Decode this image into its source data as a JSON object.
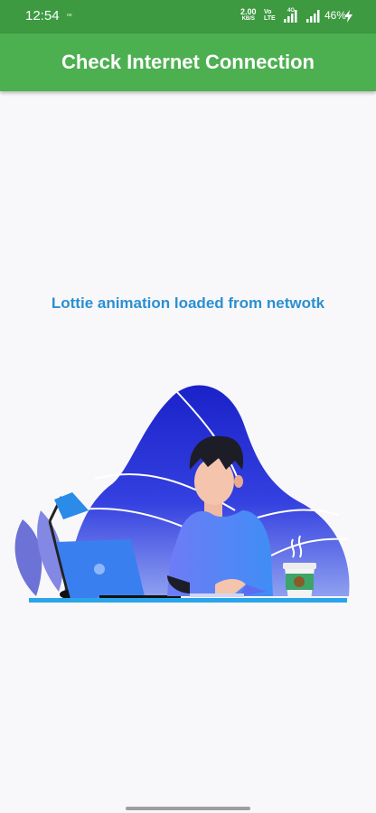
{
  "status_bar": {
    "time": "12:54",
    "app_icon": "oo",
    "net_speed": "2.00",
    "net_speed_unit": "KB/S",
    "volte_line1": "Vo",
    "volte_line2": "LTE",
    "network": "4G",
    "battery": "46%",
    "icons": [
      "signal-icon",
      "signal-icon",
      "charging-icon"
    ]
  },
  "app_bar": {
    "title": "Check Internet Connection",
    "color": "#4caf50"
  },
  "main": {
    "caption": "Lottie animation loaded from netwotk",
    "caption_color": "#2b8fd2",
    "illustration": "person-at-laptop-illustration"
  }
}
